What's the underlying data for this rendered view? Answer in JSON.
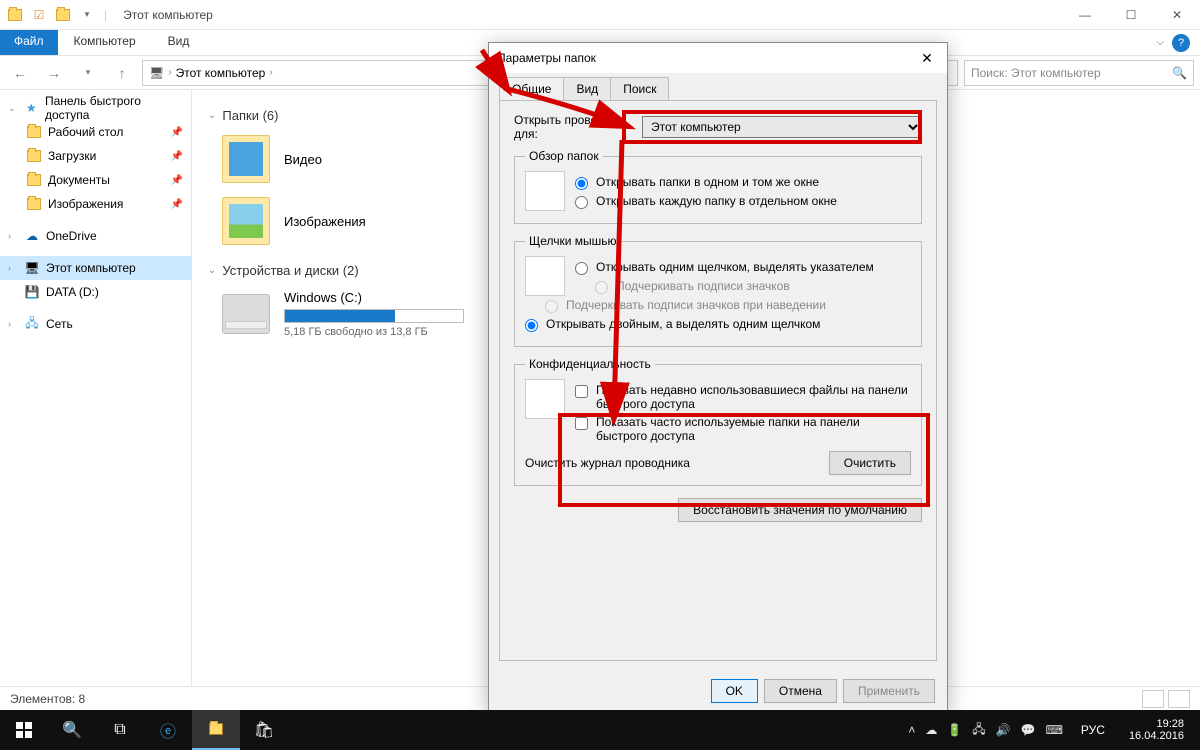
{
  "titlebar": {
    "title": "Этот компьютер"
  },
  "winbtns": {
    "min": "—",
    "max": "☐",
    "close": "✕"
  },
  "ribbon": {
    "file": "Файл",
    "computer": "Компьютер",
    "view": "Вид"
  },
  "addr": {
    "back": "←",
    "fwd": "→",
    "up": "↑",
    "root": "Этот компьютер",
    "search_placeholder": "Поиск: Этот компьютер"
  },
  "sidebar": {
    "quick": "Панель быстрого доступа",
    "desktop": "Рабочий стол",
    "downloads": "Загрузки",
    "documents": "Документы",
    "pictures": "Изображения",
    "onedrive": "OneDrive",
    "thispc": "Этот компьютер",
    "data": "DATA (D:)",
    "network": "Сеть"
  },
  "content": {
    "folders_hdr": "Папки (6)",
    "video": "Видео",
    "pictures": "Изображения",
    "drives_hdr": "Устройства и диски (2)",
    "drive_c_label": "Windows (C:)",
    "drive_c_sub": "5,18 ГБ свободно из 13,8 ГБ",
    "drive_c_fill_pct": 62
  },
  "statusbar": {
    "count": "Элементов: 8"
  },
  "dialog": {
    "title": "Параметры папок",
    "tabs": {
      "general": "Общие",
      "view": "Вид",
      "search": "Поиск"
    },
    "open_for": "Открыть проводник для:",
    "open_for_value": "Этот компьютер",
    "browse_legend": "Обзор папок",
    "browse_same": "Открывать папки в одном и том же окне",
    "browse_new": "Открывать каждую папку в отдельном окне",
    "click_legend": "Щелчки мышью",
    "click_single": "Открывать одним щелчком, выделять указателем",
    "click_underline1": "Подчеркивать подписи значков",
    "click_underline2": "Подчеркивать подписи значков при наведении",
    "click_double": "Открывать двойным, а выделять одним щелчком",
    "privacy_legend": "Конфиденциальность",
    "privacy_files": "Показать недавно использовавшиеся файлы на панели быстрого доступа",
    "privacy_folders": "Показать часто используемые папки на панели быстрого доступа",
    "clear_label": "Очистить журнал проводника",
    "clear_btn": "Очистить",
    "restore": "Восстановить значения по умолчанию",
    "ok": "OK",
    "cancel": "Отмена",
    "apply": "Применить"
  },
  "taskbar": {
    "time": "19:28",
    "date": "16.04.2016",
    "lang": "РУС"
  }
}
